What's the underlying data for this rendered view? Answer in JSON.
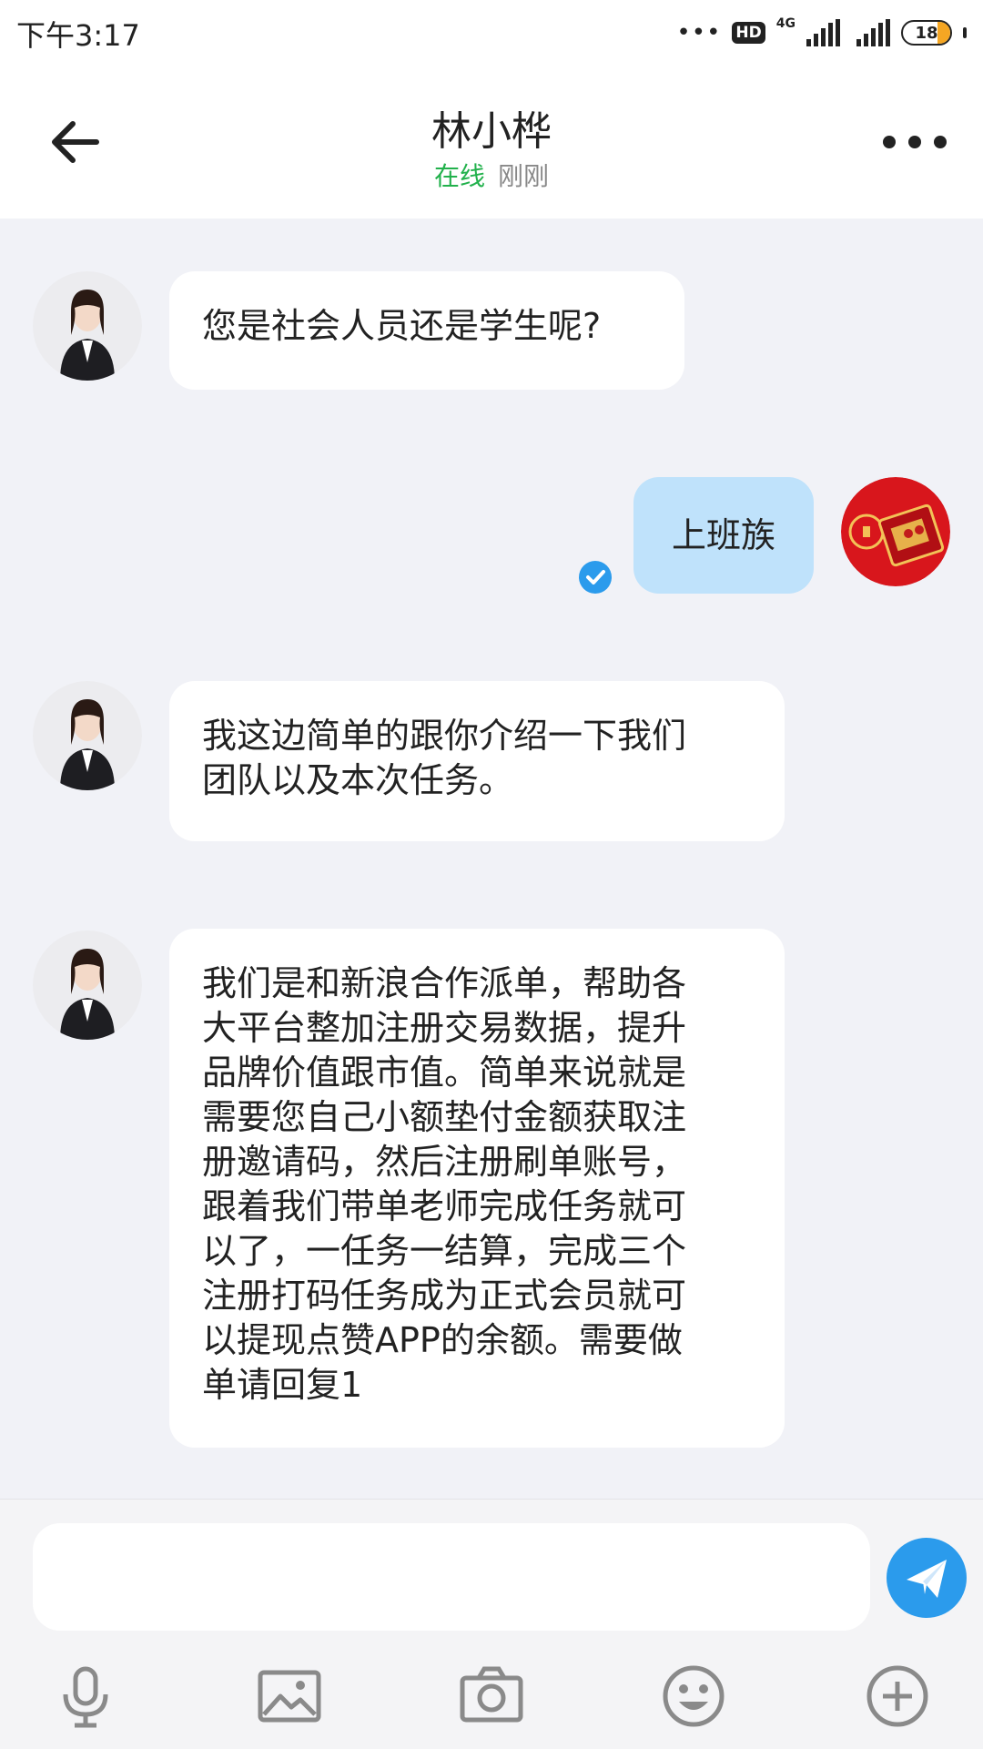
{
  "status_bar": {
    "time": "下午3:17",
    "dots": "•••",
    "hd": "HD",
    "network": "4G",
    "battery": "18"
  },
  "header": {
    "title": "林小桦",
    "status_online": "在线",
    "status_time": "刚刚"
  },
  "messages": [
    {
      "sender": "other",
      "text": "您是社会人员还是学生呢?"
    },
    {
      "sender": "me",
      "text": "上班族",
      "read": true
    },
    {
      "sender": "other",
      "lines": [
        "我这边简单的跟你介绍一下我们",
        "团队以及本次任务。"
      ]
    },
    {
      "sender": "other",
      "lines": [
        "我们是和新浪合作派单，帮助各",
        "大平台整加注册交易数据，提升",
        "品牌价值跟市值。简单来说就是",
        "需要您自己小额垫付金额获取注",
        "册邀请码，然后注册刷单账号，",
        "跟着我们带单老师完成任务就可",
        "以了，一任务一结算，完成三个",
        "注册打码任务成为正式会员就可",
        "以提现点赞APP的余额。需要做",
        "单请回复1"
      ]
    }
  ],
  "input": {
    "placeholder": ""
  },
  "toolbar": [
    "microphone-icon",
    "image-icon",
    "camera-icon",
    "emoji-icon",
    "plus-icon"
  ],
  "colors": {
    "accent": "#2b9bec",
    "online": "#22b14c",
    "my_bubble": "#bfe2fb",
    "background": "#f1f2f7"
  }
}
